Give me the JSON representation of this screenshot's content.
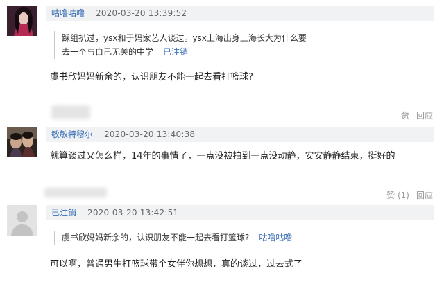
{
  "comments": [
    {
      "username": "咕噜咕噜",
      "timestamp": "2020-03-20 13:39:52",
      "quote": {
        "line1": "踩组扒过，ysx和于妈家艺人谈过。ysx上海出身上海长大为什么要",
        "line2": "去一个与自己无关的中学",
        "status": "已注销"
      },
      "body": "虞书欣妈妈新余的，认识朋友不能一起去看打篮球?",
      "like_label": "赞",
      "reply_label": "回应"
    },
    {
      "username": "敏敏特穆尔",
      "timestamp": "2020-03-20 13:40:38",
      "body": "就算谈过又怎么样，14年的事情了，一点没被拍到一点没动静，安安静静结束，挺好的",
      "like_label": "赞 (1)",
      "reply_label": "回应"
    },
    {
      "username": "已注销",
      "timestamp": "2020-03-20 13:42:51",
      "quote": {
        "text": "虞书欣妈妈新余的，认识朋友不能一起去看打篮球?",
        "author": "咕噜咕噜"
      },
      "body": "可以啊，普通男生打篮球带个女伴你想想，真的谈过，过去式了"
    }
  ],
  "colors": {
    "link": "#3a6fb6",
    "header_bg": "#f1f2f4",
    "meta": "#999999"
  }
}
